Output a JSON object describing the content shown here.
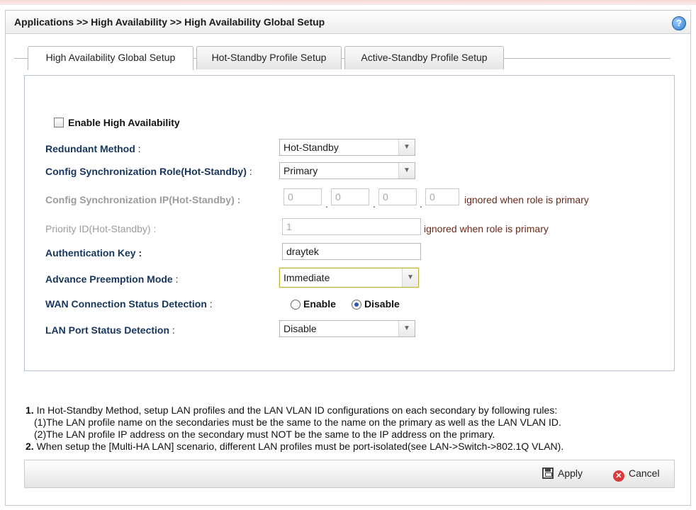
{
  "breadcrumb": "Applications >> High Availability >> High Availability Global Setup",
  "help_icon": "help-icon",
  "tabs": [
    {
      "label": "High Availability Global Setup",
      "active": true
    },
    {
      "label": "Hot-Standby Profile Setup",
      "active": false
    },
    {
      "label": "Active-Standby Profile Setup",
      "active": false
    }
  ],
  "form": {
    "enable_ha": {
      "label": "Enable High Availability",
      "checked": false
    },
    "redundant_method": {
      "label": "Redundant Method",
      "value": "Hot-Standby"
    },
    "sync_role": {
      "label": "Config Synchronization Role(Hot-Standby)",
      "value": "Primary"
    },
    "sync_ip": {
      "label": "Config Synchronization IP(Hot-Standby) :",
      "octets": [
        "0",
        "0",
        "0",
        "0"
      ],
      "dot": ".",
      "note": "ignored when role is primary"
    },
    "priority_id": {
      "label": "Priority ID(Hot-Standby) :",
      "value": "1",
      "note": "ignored when role is primary"
    },
    "auth_key": {
      "label": "Authentication Key :",
      "value": "draytek"
    },
    "preemption": {
      "label": "Advance Preemption Mode",
      "value": "Immediate"
    },
    "wan_detect": {
      "label": "WAN Connection Status Detection",
      "enable_label": "Enable",
      "disable_label": "Disable",
      "selected": "Disable"
    },
    "lan_detect": {
      "label": "LAN Port Status Detection",
      "value": "Disable"
    },
    "colon": ":"
  },
  "notes": {
    "n1": "1.",
    "l1": " In Hot-Standby Method, setup LAN profiles and the LAN VLAN ID configurations on each secondary by following rules:",
    "l2": "(1)The LAN profile name on the secondaries must be the same to the name on the primary as well as the LAN VLAN ID.",
    "l3": "(2)The LAN profile IP address on the secondary must NOT be the same to the IP address on the primary.",
    "n2": "2.",
    "l4": " When setup the [Multi-HA LAN] scenario, different LAN profiles must be port-isolated(see LAN->Switch->802.1Q VLAN)."
  },
  "buttons": {
    "apply": "Apply",
    "cancel": "Cancel"
  },
  "colors": {
    "label": "#17365d",
    "note": "#6b2a1a",
    "accent": "#2b78d4"
  }
}
